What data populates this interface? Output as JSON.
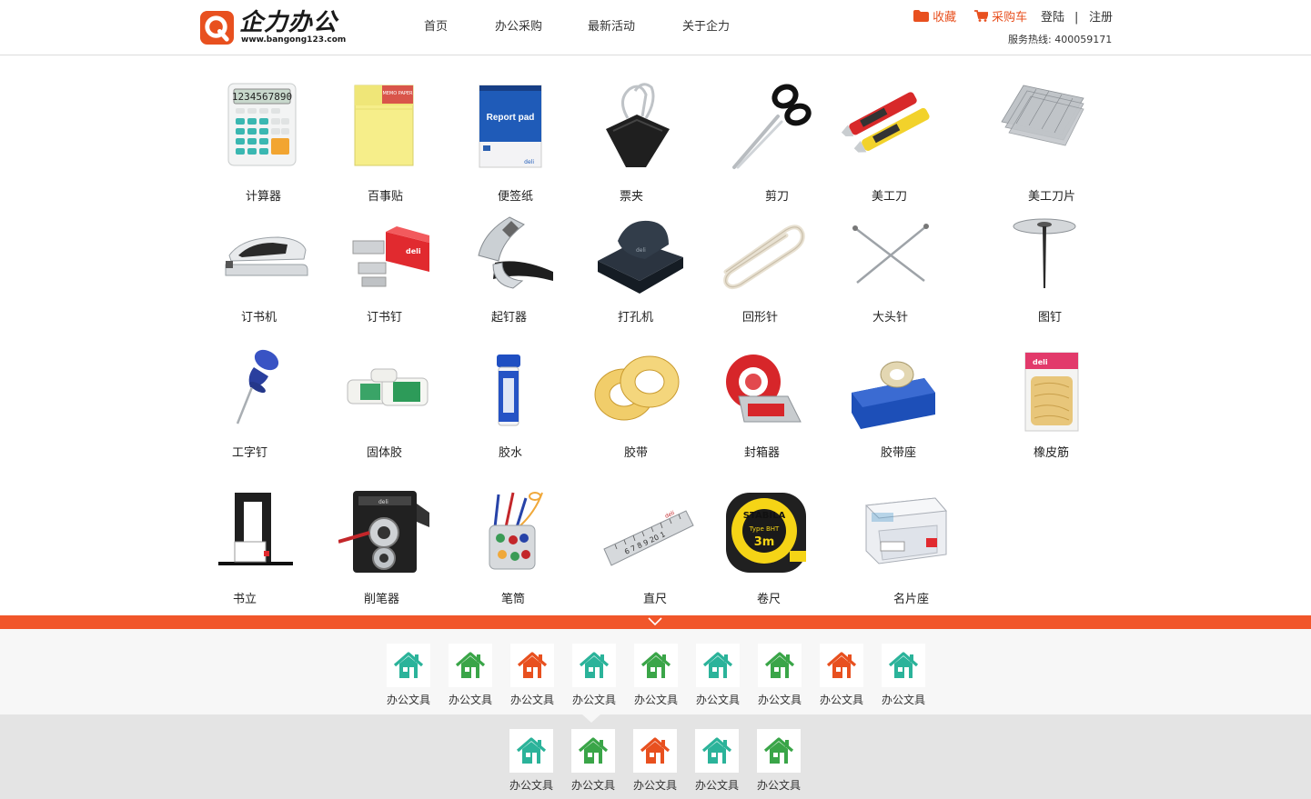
{
  "header": {
    "logo": {
      "brand": "企力办公",
      "url": "www.bangong123.com",
      "badge_letter": "Q"
    },
    "nav": [
      {
        "label": "首页"
      },
      {
        "label": "办公采购"
      },
      {
        "label": "最新活动"
      },
      {
        "label": "关于企力"
      }
    ],
    "user_bar": {
      "favorites": "收藏",
      "cart": "采购车",
      "login": "登陆",
      "separator": "|",
      "register": "注册"
    },
    "hotline": "服务热线: 400059171"
  },
  "products": [
    {
      "label": "计算器",
      "icon": "calculator-icon"
    },
    {
      "label": "百事贴",
      "icon": "sticky-note-icon"
    },
    {
      "label": "便签纸",
      "icon": "report-pad-icon",
      "pad_text": "Report pad"
    },
    {
      "label": "票夹",
      "icon": "binder-clip-icon"
    },
    {
      "label": "剪刀",
      "icon": "scissors-icon"
    },
    {
      "label": "美工刀",
      "icon": "utility-knife-icon"
    },
    {
      "label": "美工刀片",
      "icon": "knife-blades-icon"
    },
    {
      "label": "订书机",
      "icon": "stapler-icon"
    },
    {
      "label": "订书钉",
      "icon": "staples-icon"
    },
    {
      "label": "起钉器",
      "icon": "staple-remover-icon"
    },
    {
      "label": "打孔机",
      "icon": "hole-punch-icon"
    },
    {
      "label": "回形针",
      "icon": "paper-clip-icon"
    },
    {
      "label": "大头针",
      "icon": "pins-icon"
    },
    {
      "label": "图钉",
      "icon": "thumbtack-icon"
    },
    {
      "label": "工字钉",
      "icon": "push-pin-icon"
    },
    {
      "label": "固体胶",
      "icon": "glue-stick-icon"
    },
    {
      "label": "胶水",
      "icon": "liquid-glue-icon"
    },
    {
      "label": "胶带",
      "icon": "tape-roll-icon"
    },
    {
      "label": "封箱器",
      "icon": "tape-dispenser-icon"
    },
    {
      "label": "胶带座",
      "icon": "tape-holder-icon"
    },
    {
      "label": "橡皮筋",
      "icon": "rubber-band-icon"
    },
    {
      "label": "书立",
      "icon": "bookend-icon"
    },
    {
      "label": "削笔器",
      "icon": "pencil-sharpener-icon"
    },
    {
      "label": "笔筒",
      "icon": "pen-holder-icon"
    },
    {
      "label": "直尺",
      "icon": "ruler-icon",
      "ruler_text": "6 7 8 9 20 1"
    },
    {
      "label": "卷尺",
      "icon": "tape-measure-icon",
      "tm_brand": "STABILA",
      "tm_type": "Type BHT",
      "tm_size": "3m"
    },
    {
      "label": "名片座",
      "icon": "card-holder-icon"
    }
  ],
  "categories_row1": [
    {
      "label": "办公文具",
      "color": "#2bb39a"
    },
    {
      "label": "办公文具",
      "color": "#3aa548"
    },
    {
      "label": "办公文具",
      "color": "#e8501f"
    },
    {
      "label": "办公文具",
      "color": "#2bb39a"
    },
    {
      "label": "办公文具",
      "color": "#3aa548"
    },
    {
      "label": "办公文具",
      "color": "#2bb39a"
    },
    {
      "label": "办公文具",
      "color": "#3aa548"
    },
    {
      "label": "办公文具",
      "color": "#e8501f"
    },
    {
      "label": "办公文具",
      "color": "#2bb39a"
    }
  ],
  "categories_row2": [
    {
      "label": "办公文具",
      "color": "#2bb39a"
    },
    {
      "label": "办公文具",
      "color": "#3aa548"
    },
    {
      "label": "办公文具",
      "color": "#e8501f"
    },
    {
      "label": "办公文具",
      "color": "#2bb39a"
    },
    {
      "label": "办公文具",
      "color": "#3aa548"
    }
  ],
  "colors": {
    "accent": "#f1562a",
    "orange_text": "#e8501f"
  }
}
